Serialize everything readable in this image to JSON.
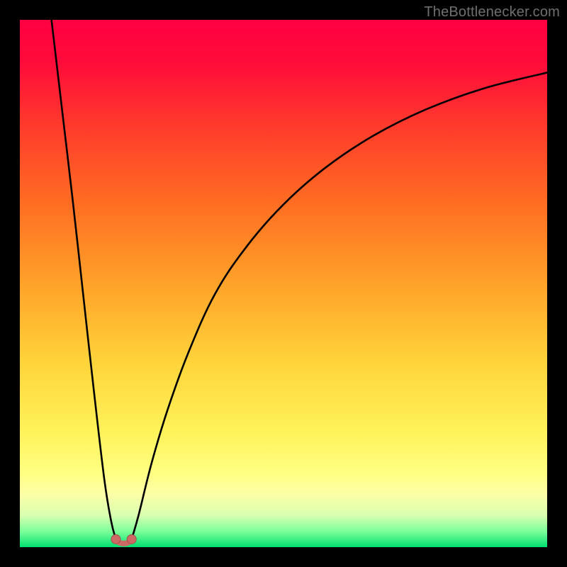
{
  "attribution": "TheBottlenecker.com",
  "colors": {
    "gradient_stops": [
      {
        "offset": 0.0,
        "color": "#ff0040"
      },
      {
        "offset": 0.08,
        "color": "#ff0b3a"
      },
      {
        "offset": 0.2,
        "color": "#ff3a2c"
      },
      {
        "offset": 0.35,
        "color": "#ff6e22"
      },
      {
        "offset": 0.5,
        "color": "#ffa229"
      },
      {
        "offset": 0.65,
        "color": "#ffd43a"
      },
      {
        "offset": 0.78,
        "color": "#fff25a"
      },
      {
        "offset": 0.86,
        "color": "#ffff82"
      },
      {
        "offset": 0.9,
        "color": "#fdffa8"
      },
      {
        "offset": 0.94,
        "color": "#d8ffb0"
      },
      {
        "offset": 0.97,
        "color": "#7dff9a"
      },
      {
        "offset": 1.0,
        "color": "#00e070"
      }
    ],
    "curve_stroke": "#000000",
    "marker_fill": "#cc6b66",
    "marker_stroke": "#a24f4a"
  },
  "chart_data": {
    "type": "line",
    "title": "",
    "xlabel": "",
    "ylabel": "",
    "xlim": [
      0,
      100
    ],
    "ylim": [
      0,
      100
    ],
    "series": [
      {
        "name": "left-branch",
        "x": [
          6,
          8,
          10,
          12,
          14,
          16,
          17.3,
          18.2
        ],
        "y": [
          100,
          83,
          66,
          48,
          30,
          13,
          5,
          1.5
        ]
      },
      {
        "name": "right-branch",
        "x": [
          21.2,
          22.5,
          25,
          28,
          32,
          37,
          43,
          50,
          58,
          67,
          77,
          88,
          100
        ],
        "y": [
          1.5,
          6,
          16,
          26,
          37,
          48,
          57,
          65,
          72,
          78,
          83,
          87,
          90
        ]
      }
    ],
    "annotations": {
      "markers": [
        {
          "x": 18.2,
          "y": 1.5
        },
        {
          "x": 21.2,
          "y": 1.5
        }
      ],
      "connector": {
        "x0": 18.2,
        "y0": 1.5,
        "x1": 21.2,
        "y1": 1.5
      }
    }
  }
}
